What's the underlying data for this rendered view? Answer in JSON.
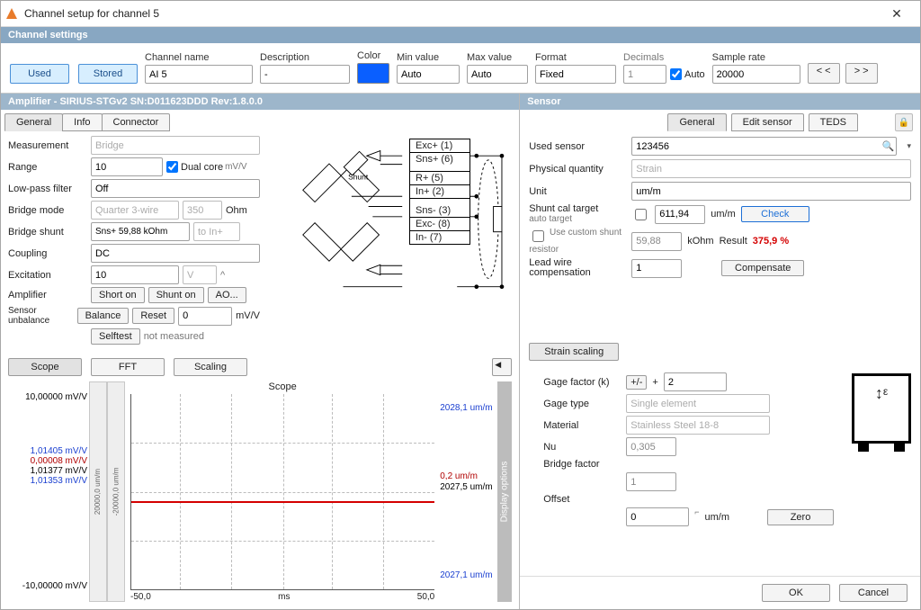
{
  "window": {
    "title": "Channel setup for channel 5",
    "section": "Channel settings"
  },
  "top": {
    "used": "Used",
    "stored": "Stored",
    "channel_name_lbl": "Channel name",
    "channel_name": "AI 5",
    "description_lbl": "Description",
    "description": "-",
    "color_lbl": "Color",
    "color": "#0a5fff",
    "min_lbl": "Min value",
    "min": "Auto",
    "max_lbl": "Max value",
    "max": "Auto",
    "format_lbl": "Format",
    "format": "Fixed",
    "decimals_lbl": "Decimals",
    "decimals": "1",
    "auto": "Auto",
    "sample_lbl": "Sample rate",
    "sample": "20000",
    "prev": "< <",
    "next": "> >"
  },
  "amp": {
    "header": "Amplifier - SIRIUS-STGv2  SN:D011623DDD Rev:1.8.0.0",
    "tabs": {
      "general": "General",
      "info": "Info",
      "connector": "Connector"
    },
    "measurement_lbl": "Measurement",
    "measurement": "Bridge",
    "range_lbl": "Range",
    "range": "10",
    "dualcore": "Dual core",
    "range_unit": "mV/V",
    "lpf_lbl": "Low-pass filter",
    "lpf": "Off",
    "bridgemode_lbl": "Bridge mode",
    "bridgemode": "Quarter 3-wire",
    "bridgeres": "350",
    "ohm": "Ohm",
    "bridgeshunt_lbl": "Bridge shunt",
    "bridgeshunt": "Sns+ 59,88 kOhm",
    "shuntto": "to In+",
    "coupling_lbl": "Coupling",
    "coupling": "DC",
    "exc_lbl": "Excitation",
    "exc": "10",
    "exc_unit": "V",
    "caret": "^",
    "ampact_lbl": "Amplifier",
    "shorton": "Short on",
    "shunton": "Shunt on",
    "ao": "AO...",
    "unbal_lbl": "Sensor unbalance",
    "balance": "Balance",
    "reset": "Reset",
    "unbal_val": "0",
    "unbal_unit": "mV/V",
    "selftest": "Selftest",
    "notmeasured": "not measured",
    "pins": {
      "excp": "Exc+ (1)",
      "snsp": "Sns+ (6)",
      "rp": "R+ (5)",
      "inp": "In+ (2)",
      "snsm": "Sns- (3)",
      "excm": "Exc- (8)",
      "inm": "In- (7)",
      "shunt": "Shunt"
    }
  },
  "scope": {
    "tabs": {
      "scope": "Scope",
      "fft": "FFT",
      "scaling": "Scaling"
    },
    "title": "Scope",
    "y_top": "10,00000 mV/V",
    "y_bot": "-10,00000 mV/V",
    "mv1": "1,01405 mV/V",
    "mv2": "0,00008 mV/V",
    "mv3": "1,01377 mV/V",
    "mv4": "1,01353 mV/V",
    "r_top": "2028,1 um/m",
    "r_mid1": "0,2 um/m",
    "r_mid2": "2027,5 um/m",
    "r_bot": "2027,1 um/m",
    "x_left": "-50,0",
    "x_right": "50,0",
    "x_unit": "ms",
    "bar_top": "20000,0 um/m",
    "bar_bot": "-20000,0 um/m",
    "dispopt": "Display options"
  },
  "sensor": {
    "header": "Sensor",
    "tabs": {
      "general": "General",
      "edit": "Edit sensor",
      "teds": "TEDS"
    },
    "used_lbl": "Used sensor",
    "used": "123456",
    "pq_lbl": "Physical quantity",
    "pq": "Strain",
    "unit_lbl": "Unit",
    "unit": "um/m",
    "shunt_lbl": "Shunt cal target",
    "shunt_sub": "auto target",
    "shunt_val": "611,94",
    "shunt_unit": "um/m",
    "check": "Check",
    "custom_lbl": "Use custom shunt resistor",
    "custom_val": "59,88",
    "kohm": "kOhm",
    "result_lbl": "Result",
    "result_val": "375,9 %",
    "lead_lbl": "Lead wire compensation",
    "lead_val": "1",
    "compensate": "Compensate"
  },
  "strain": {
    "head": "Strain scaling",
    "k_lbl": "Gage factor (k)",
    "k_prefix": "+",
    "k_toggle": "+/-",
    "k_val": "2",
    "type_lbl": "Gage type",
    "type": "Single element",
    "mat_lbl": "Material",
    "mat": "Stainless Steel 18-8",
    "nu_lbl": "Nu",
    "nu": "0,305",
    "bf_lbl": "Bridge factor",
    "bf": "1",
    "off_lbl": "Offset",
    "off": "0",
    "off_unit": "um/m",
    "zero": "Zero",
    "eps": "ε"
  },
  "footer": {
    "ok": "OK",
    "cancel": "Cancel"
  }
}
